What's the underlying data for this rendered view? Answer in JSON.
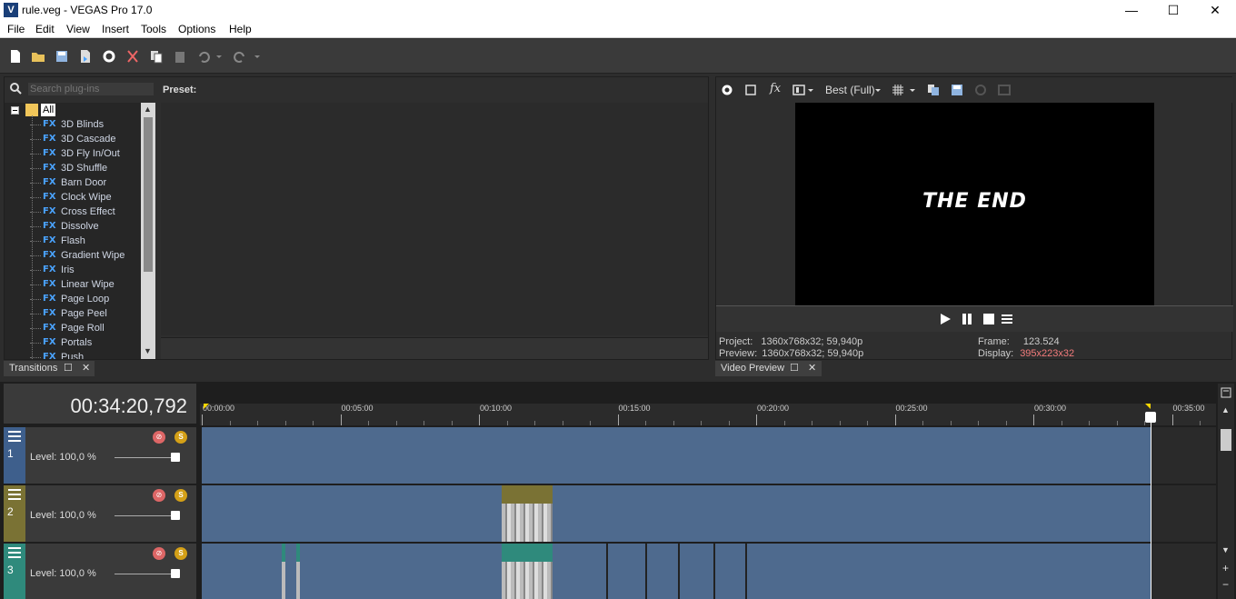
{
  "window": {
    "title": "rule.veg - VEGAS Pro 17.0",
    "app_icon": "V"
  },
  "menu": [
    "File",
    "Edit",
    "View",
    "Insert",
    "Tools",
    "Options",
    "Help"
  ],
  "plugins": {
    "search_placeholder": "Search plug-ins",
    "preset_label": "Preset:",
    "root": "All",
    "fx_badge": "FX",
    "items": [
      "3D Blinds",
      "3D Cascade",
      "3D Fly In/Out",
      "3D Shuffle",
      "Barn Door",
      "Clock Wipe",
      "Cross Effect",
      "Dissolve",
      "Flash",
      "Gradient Wipe",
      "Iris",
      "Linear Wipe",
      "Page Loop",
      "Page Peel",
      "Page Roll",
      "Portals",
      "Push"
    ]
  },
  "tabs": {
    "transitions": "Transitions",
    "video_preview": "Video Preview",
    "restore": "☐",
    "close": "✕"
  },
  "preview": {
    "quality": "Best (Full)",
    "screen_text": "THE END",
    "project_label": "Project:",
    "project_value": "1360x768x32; 59,940p",
    "preview_label": "Preview:",
    "preview_value": "1360x768x32; 59,940p",
    "frame_label": "Frame:",
    "frame_value": "123.524",
    "display_label": "Display:",
    "display_value": "395x223x32"
  },
  "timeline": {
    "timecode": "00:34:20,792",
    "ticks": [
      "00:00:00",
      "00:05:00",
      "00:10:00",
      "00:15:00",
      "00:20:00",
      "00:25:00",
      "00:30:00",
      "00:35:00"
    ],
    "tracks": [
      {
        "number": "1",
        "level": "Level: 100,0 %",
        "color": "#3e5f8c"
      },
      {
        "number": "2",
        "level": "Level: 100,0 %",
        "color": "#7a7234"
      },
      {
        "number": "3",
        "level": "Level: 100,0 %",
        "color": "#2f8a7c"
      }
    ]
  }
}
